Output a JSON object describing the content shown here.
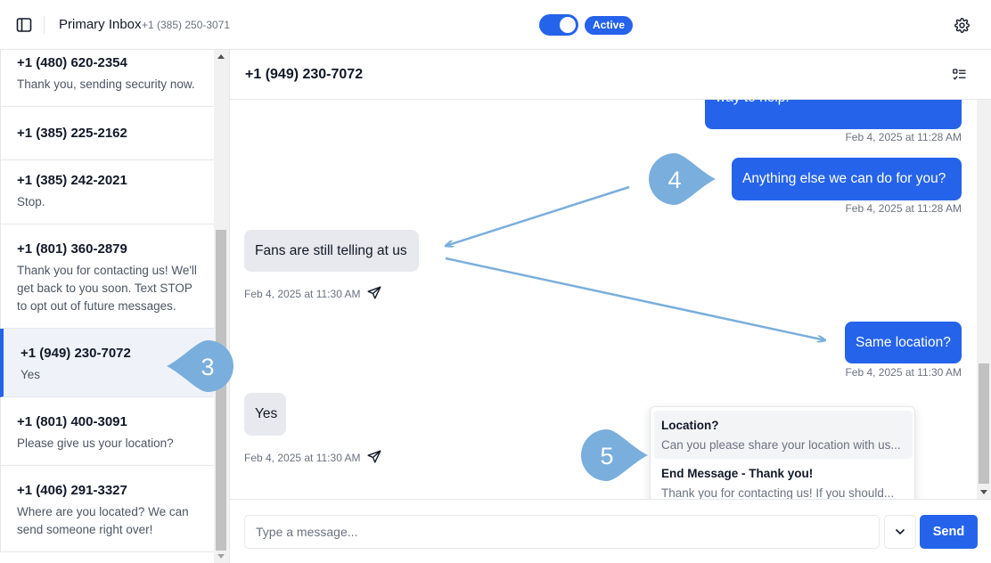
{
  "header": {
    "inbox_title": "Primary Inbox",
    "inbox_number": "+1 (385) 250-3071",
    "status": "Active",
    "toggle_on": true
  },
  "conversations": [
    {
      "phone": "+1 (480) 620-2354",
      "preview": "Thank you, sending security now."
    },
    {
      "phone": "+1 (385) 225-2162",
      "preview": ""
    },
    {
      "phone": "+1 (385) 242-2021",
      "preview": "Stop."
    },
    {
      "phone": "+1 (801) 360-2879",
      "preview": "Thank you for contacting us! We'll get back to you soon. Text STOP to opt out of future messages."
    },
    {
      "phone": "+1 (949) 230-7072",
      "preview": "Yes",
      "active": true
    },
    {
      "phone": "+1 (801) 400-3091",
      "preview": "Please give us your location?"
    },
    {
      "phone": "+1 (406) 291-3327",
      "preview": "Where are you located? We can send someone right over!"
    }
  ],
  "chat": {
    "title": "+1 (949) 230-7072",
    "messages": [
      {
        "text": "way to help.",
        "time": "Feb 4, 2025 at 11:28 AM",
        "direction": "outgoing"
      },
      {
        "text": "Anything else we can do for you?",
        "time": "Feb 4, 2025 at 11:28 AM",
        "direction": "outgoing"
      },
      {
        "text": "Fans are still telling at us",
        "time": "Feb 4, 2025 at 11:30 AM",
        "direction": "incoming"
      },
      {
        "text": "Same location?",
        "time": "Feb 4, 2025 at 11:30 AM",
        "direction": "outgoing"
      },
      {
        "text": "Yes",
        "time": "Feb 4, 2025 at 11:30 AM",
        "direction": "incoming"
      }
    ]
  },
  "templates": [
    {
      "title": "Location?",
      "body": "Can you please share your location with us..."
    },
    {
      "title": "End Message - Thank you!",
      "body": "Thank you for contacting us! If you should..."
    }
  ],
  "composer": {
    "placeholder": "Type a message...",
    "send_label": "Send"
  },
  "annotations": {
    "callout_3": "3",
    "callout_4": "4",
    "callout_5": "5",
    "color": "#7aaedc"
  }
}
